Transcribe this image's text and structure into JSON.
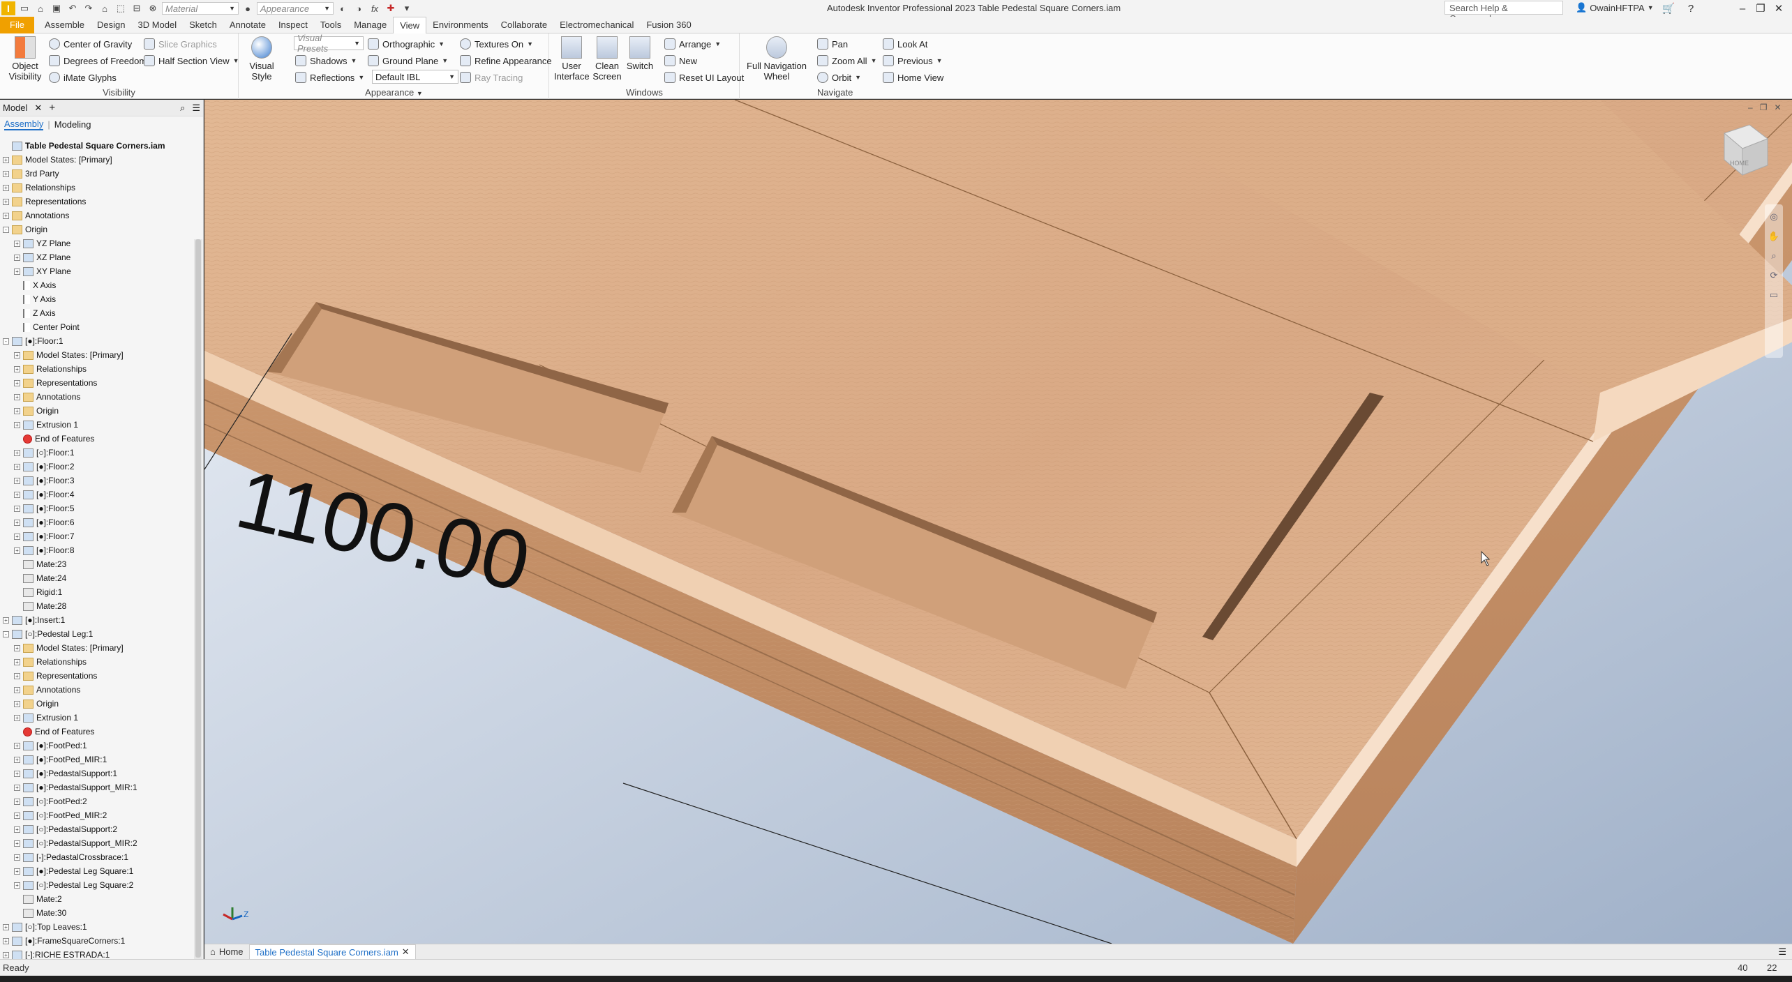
{
  "titlebar": {
    "app_title": "Autodesk Inventor Professional 2023   Table Pedestal Square Corners.iam",
    "material_label": "Material",
    "appearance_label": "Appearance",
    "search_placeholder": "Search Help & Commands...",
    "user": "OwainHFTPA"
  },
  "tabs": [
    "File",
    "Assemble",
    "Design",
    "3D Model",
    "Sketch",
    "Annotate",
    "Inspect",
    "Tools",
    "Manage",
    "View",
    "Environments",
    "Collaborate",
    "Electromechanical",
    "Fusion 360"
  ],
  "active_tab": "View",
  "ribbon": {
    "visibility": {
      "label": "Visibility",
      "object_visibility": "Object Visibility",
      "center_gravity": "Center of Gravity",
      "degrees_freedom": "Degrees of Freedom",
      "imate_glyphs": "iMate Glyphs",
      "slice_graphics": "Slice Graphics",
      "half_section": "Half Section View"
    },
    "appearance": {
      "label": "Appearance",
      "visual_style": "Visual Style",
      "visual_presets": "Visual Presets",
      "shadows": "Shadows",
      "reflections": "Reflections",
      "orthographic": "Orthographic",
      "ground_plane": "Ground Plane",
      "default_ibl": "Default IBL",
      "textures_on": "Textures On",
      "refine_appearance": "Refine Appearance",
      "ray_tracing": "Ray Tracing"
    },
    "windows": {
      "label": "Windows",
      "user_interface": "User Interface",
      "clean_screen": "Clean Screen",
      "switch": "Switch",
      "arrange": "Arrange",
      "new": "New",
      "reset_ui": "Reset UI Layout"
    },
    "navigate": {
      "label": "Navigate",
      "full_nav_wheel": "Full Navigation Wheel",
      "pan": "Pan",
      "zoom_all": "Zoom All",
      "orbit": "Orbit",
      "look_at": "Look At",
      "previous": "Previous",
      "home_view": "Home View"
    }
  },
  "browser": {
    "title": "Model",
    "tab_assembly": "Assembly",
    "tab_modeling": "Modeling",
    "tree": [
      {
        "l": 0,
        "pm": "",
        "ic": "asm",
        "t": "Table Pedestal Square Corners.iam"
      },
      {
        "l": 0,
        "pm": "+",
        "ic": "folder",
        "t": "Model States: [Primary]"
      },
      {
        "l": 0,
        "pm": "+",
        "ic": "folder",
        "t": "3rd Party"
      },
      {
        "l": 0,
        "pm": "+",
        "ic": "folder",
        "t": "Relationships"
      },
      {
        "l": 0,
        "pm": "+",
        "ic": "folder",
        "t": "Representations"
      },
      {
        "l": 0,
        "pm": "+",
        "ic": "folder",
        "t": "Annotations"
      },
      {
        "l": 0,
        "pm": "-",
        "ic": "folder",
        "t": "Origin"
      },
      {
        "l": 1,
        "pm": "+",
        "ic": "part",
        "t": "YZ Plane"
      },
      {
        "l": 1,
        "pm": "+",
        "ic": "part",
        "t": "XZ Plane"
      },
      {
        "l": 1,
        "pm": "+",
        "ic": "part",
        "t": "XY Plane"
      },
      {
        "l": 1,
        "pm": "",
        "ic": "axis",
        "t": "X Axis"
      },
      {
        "l": 1,
        "pm": "",
        "ic": "axis",
        "t": "Y Axis"
      },
      {
        "l": 1,
        "pm": "",
        "ic": "axis",
        "t": "Z Axis"
      },
      {
        "l": 1,
        "pm": "",
        "ic": "axis",
        "t": "Center Point"
      },
      {
        "l": 0,
        "pm": "-",
        "ic": "part",
        "t": "[●]:Floor:1"
      },
      {
        "l": 1,
        "pm": "+",
        "ic": "folder",
        "t": "Model States: [Primary]"
      },
      {
        "l": 1,
        "pm": "+",
        "ic": "folder",
        "t": "Relationships"
      },
      {
        "l": 1,
        "pm": "+",
        "ic": "folder",
        "t": "Representations"
      },
      {
        "l": 1,
        "pm": "+",
        "ic": "folder",
        "t": "Annotations"
      },
      {
        "l": 1,
        "pm": "+",
        "ic": "folder",
        "t": "Origin"
      },
      {
        "l": 1,
        "pm": "+",
        "ic": "part",
        "t": "Extrusion 1"
      },
      {
        "l": 1,
        "pm": "",
        "ic": "err",
        "t": "End of Features"
      },
      {
        "l": 1,
        "pm": "+",
        "ic": "part",
        "t": "[○]:Floor:1"
      },
      {
        "l": 1,
        "pm": "+",
        "ic": "part",
        "t": "[●]:Floor:2"
      },
      {
        "l": 1,
        "pm": "+",
        "ic": "part",
        "t": "[●]:Floor:3"
      },
      {
        "l": 1,
        "pm": "+",
        "ic": "part",
        "t": "[●]:Floor:4"
      },
      {
        "l": 1,
        "pm": "+",
        "ic": "part",
        "t": "[●]:Floor:5"
      },
      {
        "l": 1,
        "pm": "+",
        "ic": "part",
        "t": "[●]:Floor:6"
      },
      {
        "l": 1,
        "pm": "+",
        "ic": "part",
        "t": "[●]:Floor:7"
      },
      {
        "l": 1,
        "pm": "+",
        "ic": "part",
        "t": "[●]:Floor:8"
      },
      {
        "l": 1,
        "pm": "",
        "ic": "mate",
        "t": "Mate:23"
      },
      {
        "l": 1,
        "pm": "",
        "ic": "mate",
        "t": "Mate:24"
      },
      {
        "l": 1,
        "pm": "",
        "ic": "mate",
        "t": "Rigid:1"
      },
      {
        "l": 1,
        "pm": "",
        "ic": "mate",
        "t": "Mate:28"
      },
      {
        "l": 0,
        "pm": "+",
        "ic": "part",
        "t": "[●]:Insert:1"
      },
      {
        "l": 0,
        "pm": "-",
        "ic": "part",
        "t": "[○]:Pedestal Leg:1"
      },
      {
        "l": 1,
        "pm": "+",
        "ic": "folder",
        "t": "Model States: [Primary]"
      },
      {
        "l": 1,
        "pm": "+",
        "ic": "folder",
        "t": "Relationships"
      },
      {
        "l": 1,
        "pm": "+",
        "ic": "folder",
        "t": "Representations"
      },
      {
        "l": 1,
        "pm": "+",
        "ic": "folder",
        "t": "Annotations"
      },
      {
        "l": 1,
        "pm": "+",
        "ic": "folder",
        "t": "Origin"
      },
      {
        "l": 1,
        "pm": "+",
        "ic": "part",
        "t": "Extrusion 1"
      },
      {
        "l": 1,
        "pm": "",
        "ic": "err",
        "t": "End of Features"
      },
      {
        "l": 1,
        "pm": "+",
        "ic": "part",
        "t": "[●]:FootPed:1"
      },
      {
        "l": 1,
        "pm": "+",
        "ic": "part",
        "t": "[●]:FootPed_MIR:1"
      },
      {
        "l": 1,
        "pm": "+",
        "ic": "part",
        "t": "[●]:PedastalSupport:1"
      },
      {
        "l": 1,
        "pm": "+",
        "ic": "part",
        "t": "[●]:PedastalSupport_MIR:1"
      },
      {
        "l": 1,
        "pm": "+",
        "ic": "part",
        "t": "[○]:FootPed:2"
      },
      {
        "l": 1,
        "pm": "+",
        "ic": "part",
        "t": "[○]:FootPed_MIR:2"
      },
      {
        "l": 1,
        "pm": "+",
        "ic": "part",
        "t": "[○]:PedastalSupport:2"
      },
      {
        "l": 1,
        "pm": "+",
        "ic": "part",
        "t": "[○]:PedastalSupport_MIR:2"
      },
      {
        "l": 1,
        "pm": "+",
        "ic": "part",
        "t": "[-]:PedastalCrossbrace:1"
      },
      {
        "l": 1,
        "pm": "+",
        "ic": "part",
        "t": "[●]:Pedestal Leg Square:1"
      },
      {
        "l": 1,
        "pm": "+",
        "ic": "part",
        "t": "[○]:Pedestal Leg Square:2"
      },
      {
        "l": 1,
        "pm": "",
        "ic": "mate",
        "t": "Mate:2"
      },
      {
        "l": 1,
        "pm": "",
        "ic": "mate",
        "t": "Mate:30"
      },
      {
        "l": 0,
        "pm": "+",
        "ic": "part",
        "t": "[○]:Top Leaves:1"
      },
      {
        "l": 0,
        "pm": "+",
        "ic": "part",
        "t": "[●]:FrameSquareCorners:1"
      },
      {
        "l": 0,
        "pm": "+",
        "ic": "part",
        "t": "[-]:RICHE ESTRADA:1"
      }
    ]
  },
  "viewport": {
    "dimension_text": "1100.00",
    "viewcube_label": "HOME"
  },
  "doctabs": {
    "home": "Home",
    "active": "Table Pedestal Square Corners.iam"
  },
  "status": {
    "text": "Ready",
    "num1": "40",
    "num2": "22"
  }
}
